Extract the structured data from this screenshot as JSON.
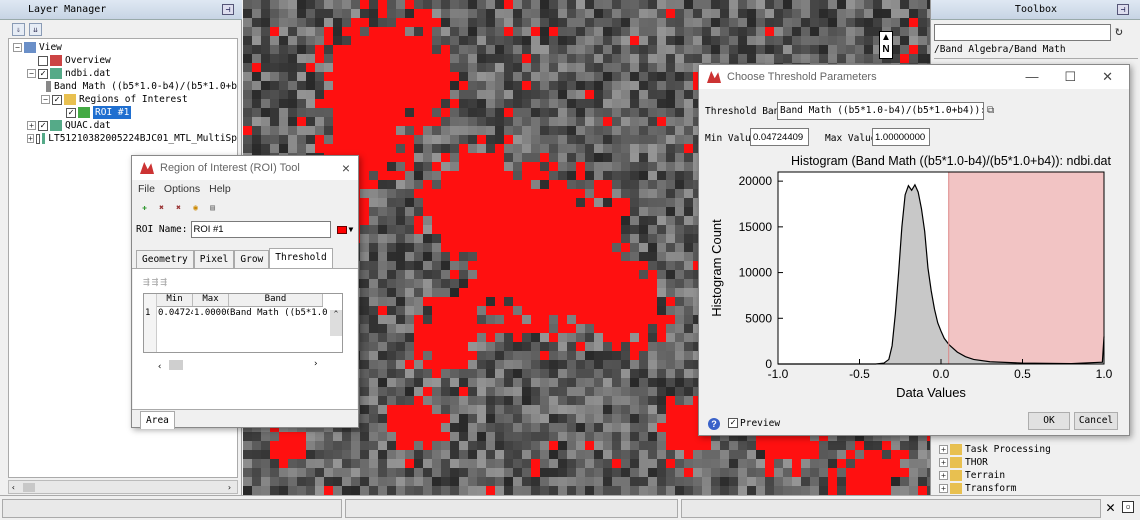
{
  "layer_manager": {
    "title": "Layer Manager",
    "tree": [
      {
        "label": "View",
        "level": 0,
        "expand": "−",
        "checkbox": null,
        "icon": "view-icon"
      },
      {
        "label": "Overview",
        "level": 1,
        "expand": null,
        "checkbox": false,
        "icon": "overview-icon"
      },
      {
        "label": "ndbi.dat",
        "level": 1,
        "expand": "−",
        "checkbox": true,
        "icon": "raster-icon"
      },
      {
        "label": "Band Math ((b5*1.0-b4)/(b5*1.0+b",
        "level": 2,
        "expand": null,
        "checkbox": null,
        "icon": "band-icon"
      },
      {
        "label": "Regions of Interest",
        "level": 2,
        "expand": "−",
        "checkbox": true,
        "icon": "folder-icon"
      },
      {
        "label": "ROI #1",
        "level": 3,
        "expand": null,
        "checkbox": true,
        "icon": "roi-icon",
        "selected": true
      },
      {
        "label": "QUAC.dat",
        "level": 1,
        "expand": "+",
        "checkbox": true,
        "icon": "raster-icon"
      },
      {
        "label": "LT51210382005224BJC01_MTL_MultiSp",
        "level": 1,
        "expand": "+",
        "checkbox": false,
        "icon": "raster-icon"
      }
    ]
  },
  "toolbox": {
    "title": "Toolbox",
    "search_value": "",
    "path": "/Band Algebra/Band Math",
    "items": [
      "Task Processing",
      "THOR",
      "Terrain",
      "Transform"
    ]
  },
  "roi_tool": {
    "title": "Region of Interest (ROI) Tool",
    "menu": [
      "File",
      "Options",
      "Help"
    ],
    "roi_name_label": "ROI Name",
    "roi_name_value": "ROI #1",
    "roi_color": "#ff0000",
    "tabs": [
      "Geometry",
      "Pixel",
      "Grow",
      "Threshold"
    ],
    "active_tab": "Threshold",
    "table_headers": [
      "Min",
      "Max",
      "Band"
    ],
    "table_rows": [
      {
        "index": "1",
        "min": "0.04724",
        "max": "1.00000",
        "band": "Band Math ((b5*1.0-"
      }
    ],
    "area_label": "Area"
  },
  "threshold_dialog": {
    "title": "Choose Threshold Parameters",
    "threshold_band_label": "Threshold Band",
    "threshold_band_value": "Band Math ((b5*1.0-b4)/(b5*1.0+b4)): ndbi",
    "min_label": "Min Value",
    "min_value": "0.04724409",
    "max_label": "Max Value",
    "max_value": "1.00000000",
    "preview_label": "Preview",
    "preview_checked": true,
    "ok_label": "OK",
    "cancel_label": "Cancel"
  },
  "chart_data": {
    "type": "area",
    "title": "Histogram (Band Math ((b5*1.0-b4)/(b5*1.0+b4)): ndbi.dat",
    "xlabel": "Data Values",
    "ylabel": "Histogram Count",
    "xlim": [
      -1.0,
      1.0
    ],
    "ylim": [
      0,
      21000
    ],
    "xticks": [
      "-1.0",
      "-0.5",
      "0.0",
      "0.5",
      "1.0"
    ],
    "yticks": [
      "0",
      "5000",
      "10000",
      "15000",
      "20000"
    ],
    "selected_range": [
      0.04724409,
      1.0
    ],
    "selection_color": "#f2c4c4",
    "series": [
      {
        "x": [
          -1.0,
          -0.7,
          -0.4,
          -0.35,
          -0.32,
          -0.3,
          -0.28,
          -0.26,
          -0.24,
          -0.22,
          -0.2,
          -0.18,
          -0.16,
          -0.14,
          -0.12,
          -0.1,
          -0.08,
          -0.06,
          -0.04,
          -0.02,
          0.0,
          0.02,
          0.05,
          0.1,
          0.15,
          0.2,
          0.3,
          0.5,
          0.8,
          0.99,
          1.0
        ],
        "values": [
          0,
          0,
          0,
          100,
          500,
          2000,
          5500,
          10000,
          15000,
          18500,
          19500,
          19000,
          19600,
          18800,
          17000,
          14500,
          10500,
          8000,
          6000,
          4500,
          3600,
          2800,
          2100,
          1300,
          800,
          500,
          250,
          100,
          50,
          200,
          3000
        ]
      }
    ]
  },
  "status": {
    "close_icon": "close-icon"
  }
}
